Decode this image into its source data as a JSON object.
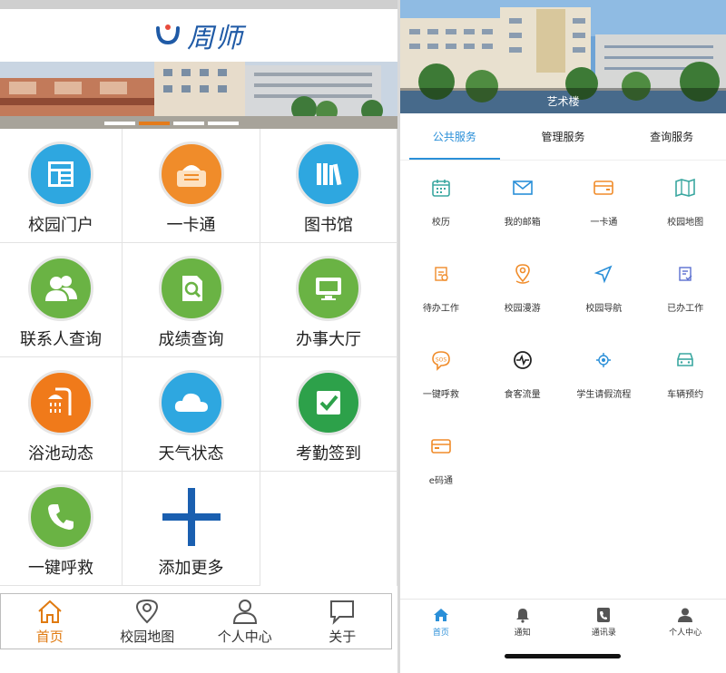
{
  "left": {
    "logo_text": "周师",
    "grid": [
      {
        "label": "校园门户",
        "icon": "portal-icon",
        "color": "#2ea7e0"
      },
      {
        "label": "一卡通",
        "icon": "card-icon",
        "color": "#f08c2a"
      },
      {
        "label": "图书馆",
        "icon": "library-icon",
        "color": "#2ea7e0"
      },
      {
        "label": "联系人查询",
        "icon": "contacts-icon",
        "color": "#6ab344"
      },
      {
        "label": "成绩查询",
        "icon": "grades-icon",
        "color": "#6ab344"
      },
      {
        "label": "办事大厅",
        "icon": "service-hall-icon",
        "color": "#6ab344"
      },
      {
        "label": "浴池动态",
        "icon": "shower-icon",
        "color": "#f07a1a"
      },
      {
        "label": "天气状态",
        "icon": "weather-icon",
        "color": "#2ea7e0"
      },
      {
        "label": "考勤签到",
        "icon": "checkin-icon",
        "color": "#2da14a"
      },
      {
        "label": "一键呼救",
        "icon": "phone-icon",
        "color": "#6ab344"
      },
      {
        "label": "添加更多",
        "icon": "plus-icon",
        "color": "#1a5fb0"
      }
    ],
    "nav": [
      {
        "label": "首页",
        "icon": "home-icon"
      },
      {
        "label": "校园地图",
        "icon": "map-pin-icon"
      },
      {
        "label": "个人中心",
        "icon": "person-icon"
      },
      {
        "label": "关于",
        "icon": "chat-bubble-icon"
      }
    ]
  },
  "right": {
    "banner_caption": "艺术楼",
    "tabs": [
      "公共服务",
      "管理服务",
      "查询服务"
    ],
    "services": [
      {
        "label": "校历",
        "icon": "calendar-icon",
        "color": "#3aa7a0"
      },
      {
        "label": "我的邮箱",
        "icon": "mail-icon",
        "color": "#2a8fd8"
      },
      {
        "label": "一卡通",
        "icon": "card-icon",
        "color": "#f08c2a"
      },
      {
        "label": "校园地图",
        "icon": "map-icon",
        "color": "#3aa7a0"
      },
      {
        "label": "待办工作",
        "icon": "todo-icon",
        "color": "#f08c2a"
      },
      {
        "label": "校园漫游",
        "icon": "location-icon",
        "color": "#f08c2a"
      },
      {
        "label": "校园导航",
        "icon": "navigation-icon",
        "color": "#2a8fd8"
      },
      {
        "label": "已办工作",
        "icon": "done-icon",
        "color": "#5a6fd0"
      },
      {
        "label": "一键呼救",
        "icon": "sos-icon",
        "color": "#f08c2a"
      },
      {
        "label": "食客流量",
        "icon": "pulse-icon",
        "color": "#222222"
      },
      {
        "label": "学生请假流程",
        "icon": "flow-icon",
        "color": "#2a8fd8"
      },
      {
        "label": "车辆预约",
        "icon": "car-icon",
        "color": "#3aa7a0"
      },
      {
        "label": "e码通",
        "icon": "ecode-icon",
        "color": "#f08c2a"
      }
    ],
    "nav": [
      {
        "label": "首页",
        "icon": "home-icon"
      },
      {
        "label": "通知",
        "icon": "bell-icon"
      },
      {
        "label": "通讯录",
        "icon": "contacts-book-icon"
      },
      {
        "label": "个人中心",
        "icon": "person-icon"
      }
    ]
  }
}
